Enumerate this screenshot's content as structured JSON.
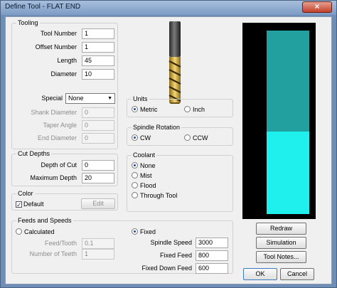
{
  "window": {
    "title": "Define Tool - FLAT END",
    "close_glyph": "×"
  },
  "tooling": {
    "label": "Tooling",
    "fields": [
      {
        "label": "Tool Number",
        "value": "1"
      },
      {
        "label": "Offset Number",
        "value": "1"
      },
      {
        "label": "Length",
        "value": "45"
      },
      {
        "label": "Diameter",
        "value": "10"
      }
    ],
    "special_label": "Special",
    "special_value": "None",
    "disabled_fields": [
      {
        "label": "Shank Diameter",
        "value": "0"
      },
      {
        "label": "Taper Angle",
        "value": "0"
      },
      {
        "label": "End Diameter",
        "value": "0"
      }
    ]
  },
  "units": {
    "label": "Units",
    "options": [
      "Metric",
      "Inch"
    ],
    "selected": "Metric"
  },
  "spindle_rotation": {
    "label": "Spindle Rotation",
    "options": [
      "CW",
      "CCW"
    ],
    "selected": "CW"
  },
  "coolant": {
    "label": "Coolant",
    "options": [
      "None",
      "Mist",
      "Flood",
      "Through Tool"
    ],
    "selected": "None"
  },
  "cut_depths": {
    "label": "Cut Depths",
    "fields": [
      {
        "label": "Depth of Cut",
        "value": "0"
      },
      {
        "label": "Maximum Depth",
        "value": "20"
      }
    ]
  },
  "color": {
    "label": "Color",
    "default_label": "Default",
    "default_checked": true,
    "edit_label": "Edit"
  },
  "feeds": {
    "label": "Feeds and Speeds",
    "calculated_label": "Calculated",
    "fixed_label": "Fixed",
    "selected": "Fixed",
    "left_fields": [
      {
        "label": "Feed/Tooth",
        "value": "0.1"
      },
      {
        "label": "Number of Teeth",
        "value": "1"
      }
    ],
    "right_fields": [
      {
        "label": "Spindle Speed",
        "value": "3000"
      },
      {
        "label": "Fixed Feed",
        "value": "800"
      },
      {
        "label": "Fixed Down Feed",
        "value": "600"
      }
    ]
  },
  "buttons": {
    "redraw": "Redraw",
    "simulation": "Simulation",
    "tool_notes": "Tool Notes...",
    "ok": "OK",
    "cancel": "Cancel"
  },
  "colors": {
    "preview_bg": "#000000",
    "shank": "#22a0a0",
    "flutes": "#1ff0ee",
    "tool_gold": "#d6b34a"
  }
}
